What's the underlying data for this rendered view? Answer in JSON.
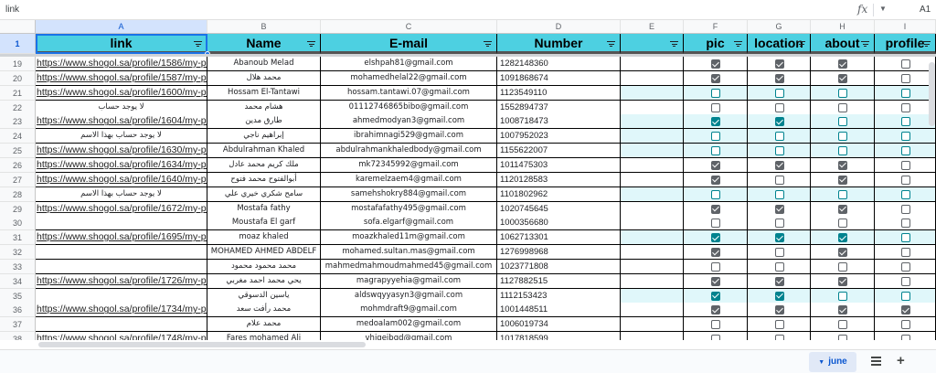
{
  "formula_bar": {
    "name_box": "link",
    "fx_label": "fx",
    "cell_ref": "A1"
  },
  "columns": [
    {
      "letter": "A",
      "header": "link",
      "selected": true
    },
    {
      "letter": "B",
      "header": "Name"
    },
    {
      "letter": "C",
      "header": "E-mail"
    },
    {
      "letter": "D",
      "header": "Number"
    },
    {
      "letter": "E",
      "header": ""
    },
    {
      "letter": "F",
      "header": "pic"
    },
    {
      "letter": "G",
      "header": "location"
    },
    {
      "letter": "H",
      "header": "about"
    },
    {
      "letter": "I",
      "header": "profile"
    }
  ],
  "header_row_number": "1",
  "rows": [
    {
      "num": "19",
      "link": "https://www.shogol.sa/profile/1586/my-profile",
      "name": "Abanoub Melad",
      "email": "elshpah81@gmail.com",
      "number": "1282148360",
      "teal_e": false,
      "pic": true,
      "location": true,
      "about": true,
      "profile": false
    },
    {
      "num": "20",
      "link": "https://www.shogol.sa/profile/1587/my-profile",
      "name": "محمد هلال",
      "email": "mohamedhelal22@gmail.com",
      "number": "1091868674",
      "teal_e": false,
      "pic": true,
      "location": true,
      "about": true,
      "profile": false
    },
    {
      "num": "21",
      "link": "https://www.shogol.sa/profile/1600/my-profile",
      "name": "Hossam El-Tantawi",
      "email": "hossam.tantawi.07@gmail.com",
      "number": "1123549110",
      "teal_e": true,
      "pic": false,
      "location": false,
      "about": false,
      "profile": false
    },
    {
      "num": "22",
      "link": "لا يوجد حساب",
      "link_plain": true,
      "name": "هشام محمد",
      "email": "0111274686​5bibo@gmail.com",
      "number": "1552894737",
      "teal_e": false,
      "pic": false,
      "location": false,
      "about": false,
      "profile": false
    },
    {
      "num": "23",
      "link": "https://www.shogol.sa/profile/1604/my-profile",
      "name": "طارق مدين",
      "email": "ahmedmodyan3@gmail.com",
      "number": "1008718473",
      "teal_e": true,
      "pic": true,
      "location": true,
      "about": false,
      "profile": false
    },
    {
      "num": "24",
      "link": "لا يوجد حساب بهذا الاسم",
      "link_plain": true,
      "name": "إبراهيم ناجي",
      "email": "ibrahimnagi529@gmail.com",
      "number": "1007952023",
      "teal_e": true,
      "pic": false,
      "location": false,
      "about": false,
      "profile": false
    },
    {
      "num": "25",
      "link": "https://www.shogol.sa/profile/1630/my-profile",
      "name": "Abdulrahman Khaled",
      "email": "abdulrahmankhaledbody@gmail.com",
      "number": "1155622007",
      "teal_e": true,
      "pic": false,
      "location": false,
      "about": false,
      "profile": false
    },
    {
      "num": "26",
      "link": "https://www.shogol.sa/profile/1634/my-profile",
      "name": "ملك كريم محمد عادل",
      "email": "mk72345992@gmail.com",
      "number": "1011475303",
      "teal_e": false,
      "pic": true,
      "location": true,
      "about": true,
      "profile": false
    },
    {
      "num": "27",
      "link": "https://www.shogol.sa/profile/1640/my-profile",
      "name": "أبوالفتوح محمد فتوح",
      "email": "karemelzaem4@gmail.com",
      "number": "1120128583",
      "teal_e": false,
      "pic": true,
      "location": false,
      "about": true,
      "profile": false
    },
    {
      "num": "28",
      "link": "لا يوجد حساب بهذا الاسم",
      "link_plain": true,
      "name": "سامح شكري خيري علي",
      "email": "samehshokry884@gmail.com",
      "number": "1101802962",
      "teal_e": true,
      "pic": false,
      "location": false,
      "about": false,
      "profile": false
    },
    {
      "num": "29",
      "link": "https://www.shogol.sa/profile/1672/my-profile",
      "name": "Mostafa fathy",
      "email": "mostafafathy495@gmail.com",
      "number": "1020745645",
      "teal_e": false,
      "pic": true,
      "location": true,
      "about": true,
      "profile": false
    },
    {
      "num": "30",
      "link": "",
      "name": "Moustafa El garf",
      "email": "sofa.elgarf@gmail.com",
      "number": "1000356680",
      "teal_e": false,
      "pic": false,
      "location": false,
      "about": false,
      "profile": false
    },
    {
      "num": "31",
      "link": "https://www.shogol.sa/profile/1695/my-profile",
      "name": "moaz khaled",
      "email": "moazkhaled11m@gmail.com",
      "number": "1062713301",
      "teal_e": true,
      "pic": true,
      "location": true,
      "about": true,
      "profile": false
    },
    {
      "num": "32",
      "link": "",
      "name": "MOHAMED AHMED ABDELF",
      "email": "mohamed.sultan.mas@gmail.com",
      "number": "1276998968",
      "teal_e": false,
      "pic": true,
      "location": false,
      "about": true,
      "profile": false
    },
    {
      "num": "33",
      "link": "",
      "name": "محمد محمود محمود",
      "email": "mahmedmahmoudmahmed45@gmail.com",
      "number": "1023771808",
      "teal_e": false,
      "pic": false,
      "location": false,
      "about": false,
      "profile": false
    },
    {
      "num": "34",
      "link": "https://www.shogol.sa/profile/1726/my-profile",
      "name": "يحي محمد احمد مغربي",
      "email": "magrapyyehia@gmail.com",
      "number": "1127882515",
      "teal_e": false,
      "pic": true,
      "location": true,
      "about": true,
      "profile": false
    },
    {
      "num": "35",
      "link": "",
      "name": "ياسين الدسوقي",
      "email": "aldswqyyasyn3@gmail.com",
      "number": "1112153423",
      "teal_e": true,
      "pic": true,
      "location": true,
      "about": false,
      "profile": false
    },
    {
      "num": "36",
      "link": "https://www.shogol.sa/profile/1734/my-profile",
      "name": "محمد رأفت سعد",
      "email": "mohmdraft9@gmail.com",
      "number": "1001448511",
      "teal_e": false,
      "pic": true,
      "location": true,
      "about": true,
      "profile": true
    },
    {
      "num": "37",
      "link": "",
      "name": "محمد علام",
      "email": "medoalam002@gmail.com",
      "number": "1006019734",
      "teal_e": false,
      "pic": false,
      "location": false,
      "about": false,
      "profile": false
    },
    {
      "num": "38",
      "link": "https://www.shogol.sa/profile/1748/my-profile",
      "name": "Fares mohamed Ali",
      "email": "vhjgeibgd@gmail.com",
      "number": "1017818599",
      "teal_e": false,
      "pic": false,
      "location": false,
      "about": false,
      "profile": false
    }
  ],
  "sheet_tabs": [
    {
      "label": "june",
      "active": true
    }
  ],
  "icons": {
    "filter": "filter-icon",
    "all_sheets": "all-sheets-menu-icon",
    "add_sheet": "add-sheet-icon",
    "fx": "function-icon",
    "dropdown": "chevron-down-icon"
  },
  "colors": {
    "header_fill": "#4dd0e1",
    "teal_row_fill": "#e0f7fa",
    "selection": "#1a73e8",
    "checkbox": "#5f6368",
    "checkbox_teal": "#00838f"
  }
}
